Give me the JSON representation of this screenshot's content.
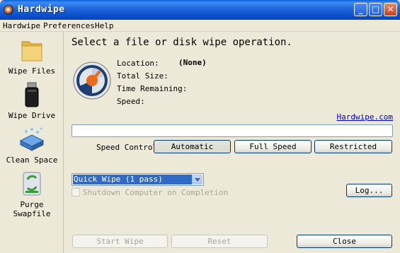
{
  "window": {
    "title": "Hardwipe",
    "min": "_",
    "max": "□",
    "close": "✕"
  },
  "menu": [
    {
      "label": "Hardwipe"
    },
    {
      "label": "Preferences"
    },
    {
      "label": "Help"
    }
  ],
  "sidebar": [
    {
      "label": "Wipe Files",
      "icon": "folder-icon"
    },
    {
      "label": "Wipe Drive",
      "icon": "usb-drive-icon"
    },
    {
      "label": "Clean Space",
      "icon": "disk-clean-icon"
    },
    {
      "label": "Purge Swapfile",
      "icon": "swapfile-icon"
    }
  ],
  "main": {
    "heading": "Select a file or disk wipe operation.",
    "info": {
      "location_label": "Location:",
      "location_value": "(None)",
      "total_size_label": "Total Size:",
      "time_remaining_label": "Time Remaining:",
      "speed_label": "Speed:"
    },
    "link": "Hardwipe.com",
    "progress": 0,
    "speed_control_label": "Speed Control:",
    "speed_buttons": [
      "Automatic",
      "Full Speed",
      "Restricted"
    ],
    "wipe_method": "Quick Wipe (1 pass)",
    "shutdown_label": "Shutdown Computer on Completion",
    "log_button": "Log...",
    "start_button": "Start Wipe",
    "reset_button": "Reset",
    "close_button": "Close"
  },
  "colors": {
    "accent": "#0a4fc9",
    "selection": "#316ac5",
    "link": "#0000cc"
  }
}
